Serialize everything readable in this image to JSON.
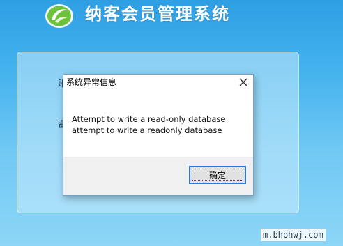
{
  "app": {
    "title": "纳客会员管理系统",
    "logo_icon": "leaf-swirl-logo-icon"
  },
  "login_panel": {
    "partial_labels": [
      "账",
      "密"
    ]
  },
  "dialog": {
    "title": "系统异常信息",
    "close_icon": "close-icon",
    "message_lines": [
      "Attempt to write a read-only database",
      "attempt to write a readonly database"
    ],
    "ok_label": "确定"
  },
  "watermark": "m.bhphwj.com",
  "colors": {
    "background_top": "#2f9fe4",
    "background_bottom": "#8dd6f7",
    "button_focus_border": "#2a7bd5",
    "footer_bg": "#f0f0f0"
  }
}
